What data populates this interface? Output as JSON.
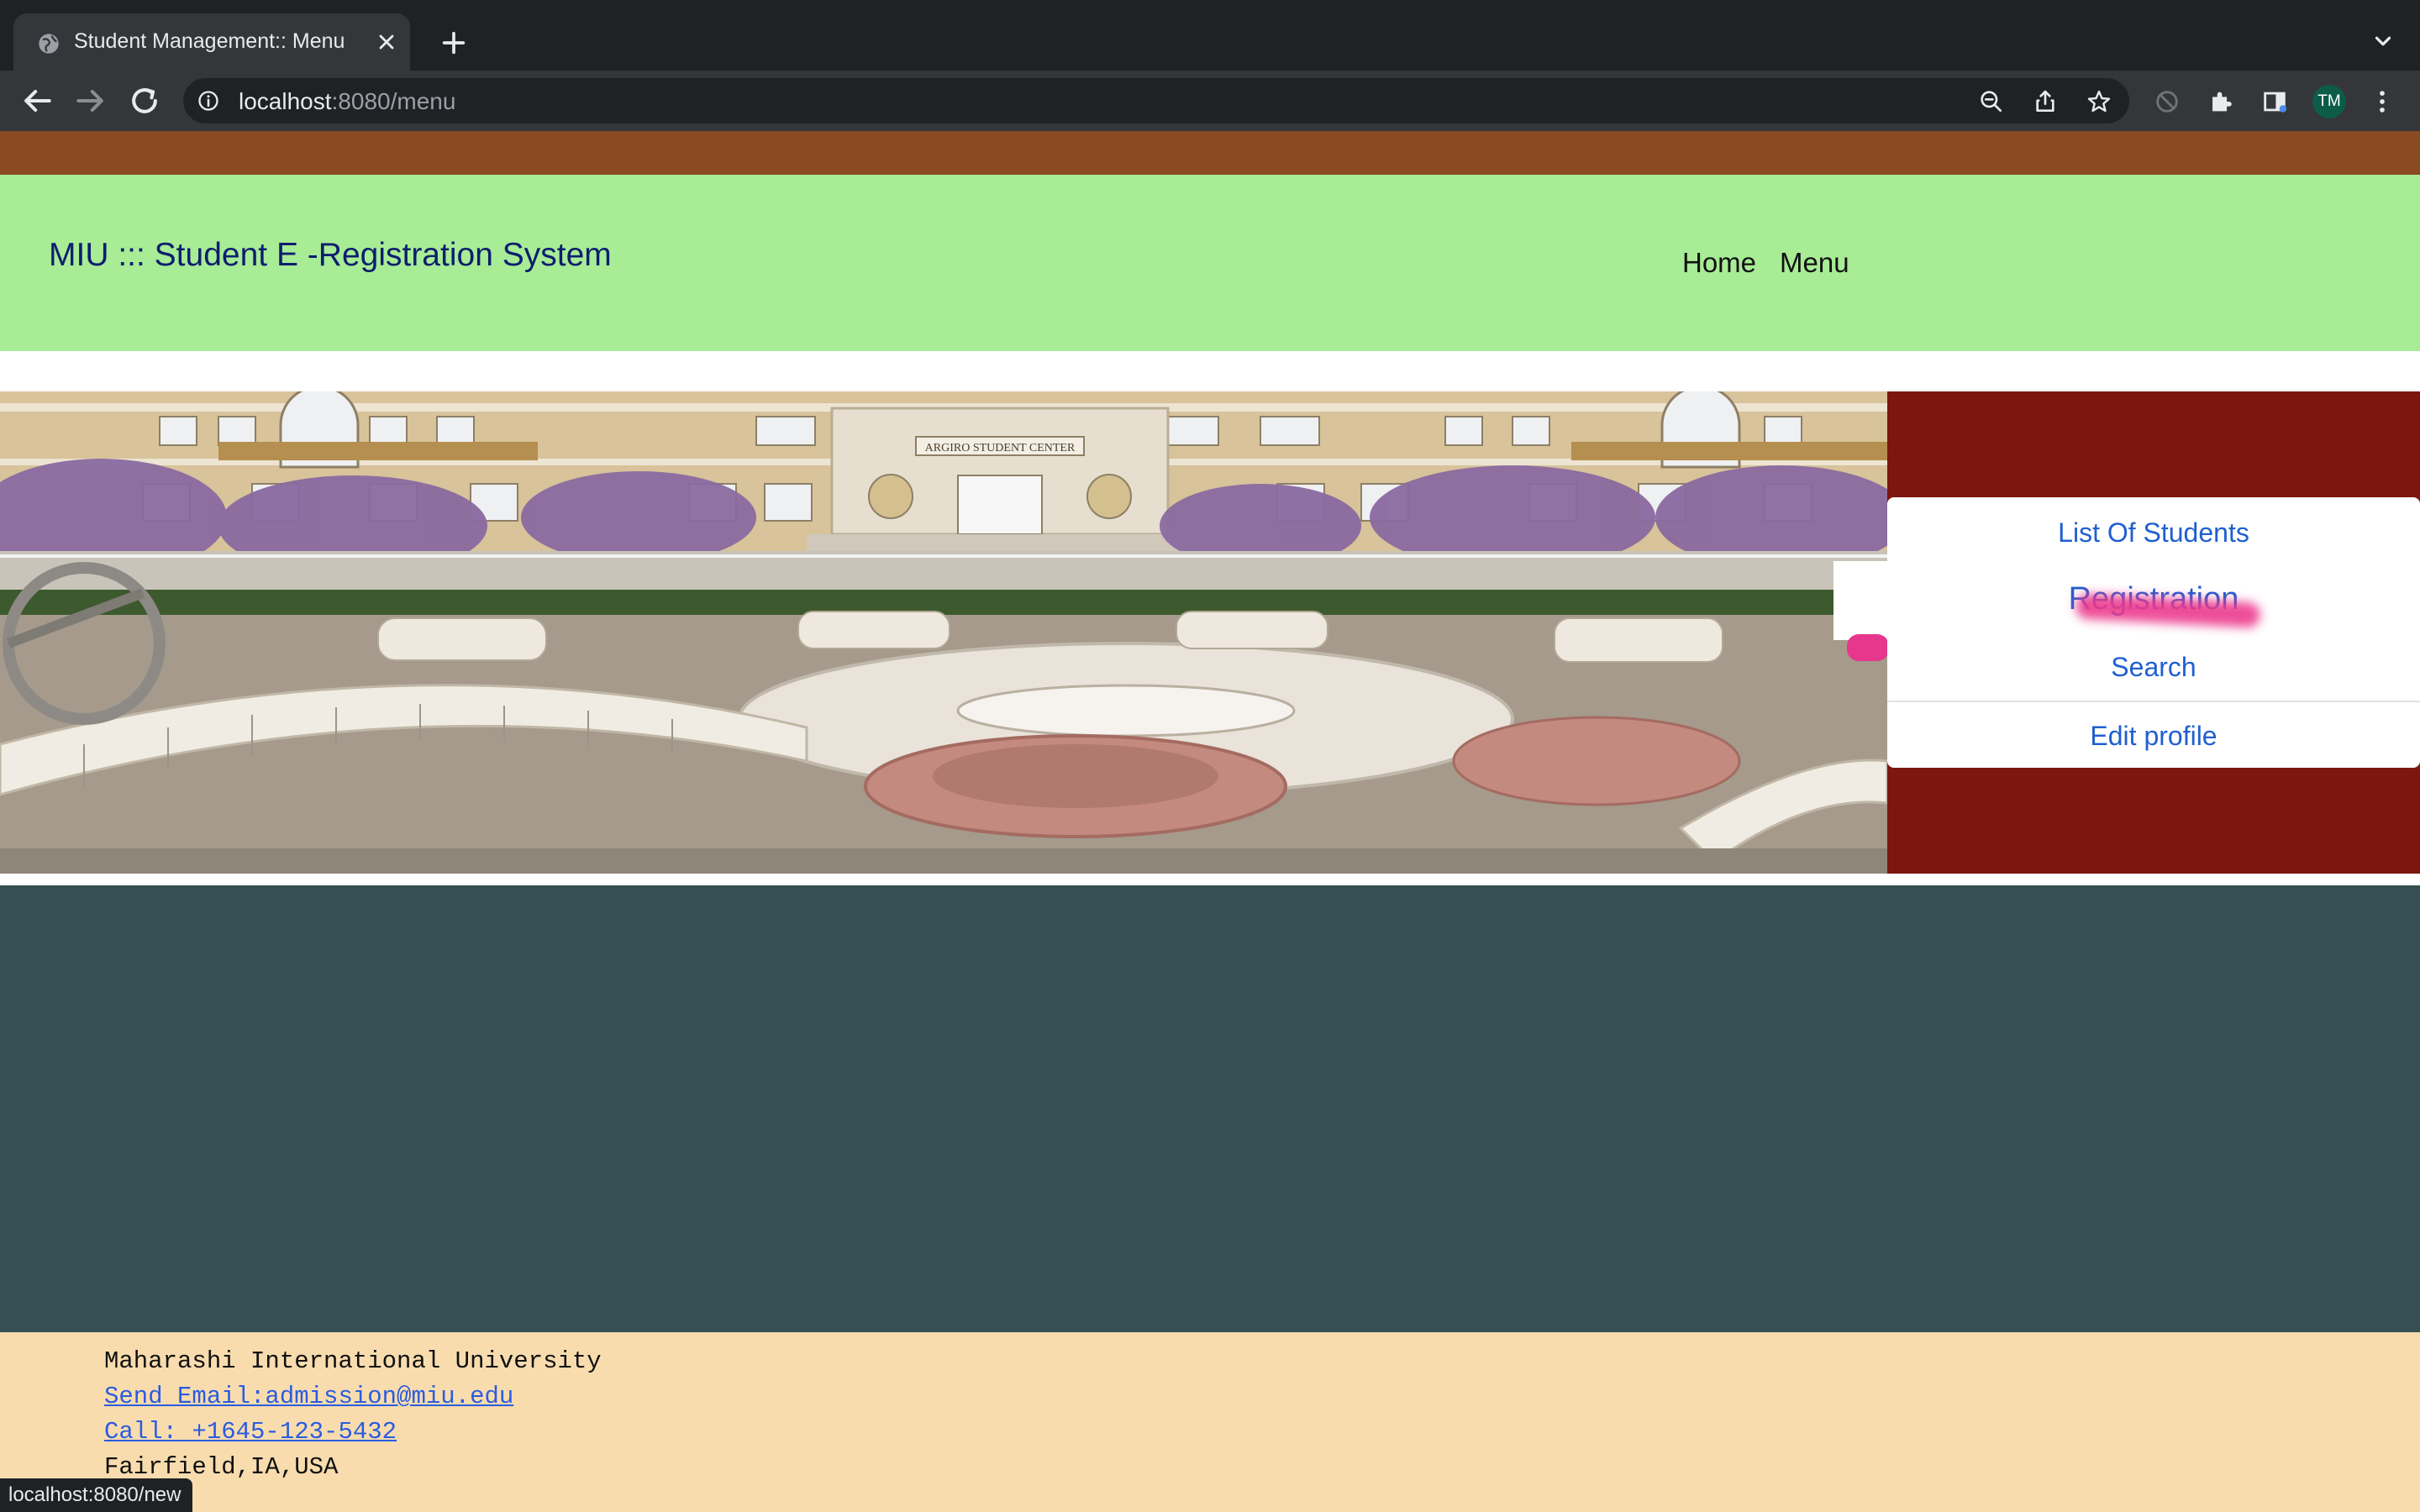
{
  "browser": {
    "tab_title": "Student Management:: Menu",
    "url_host": "localhost",
    "url_rest": ":8080/menu",
    "profile_initials": "TM",
    "status_url": "localhost:8080/new"
  },
  "header": {
    "brand": "MIU ::: Student E -Registration System",
    "nav": [
      "Home",
      "Menu"
    ]
  },
  "side_menu": {
    "items": [
      "List Of Students",
      "Registration",
      "Search",
      "Edit profile"
    ],
    "active_index": 1
  },
  "hero": {
    "building_sign": "ARGIRO STUDENT CENTER"
  },
  "footer": {
    "university": "Maharashi International University",
    "email": "Send Email:admission@miu.edu",
    "phone": "Call: +1645-123-5432",
    "location": "Fairfield,IA,USA"
  },
  "colors": {
    "brown_bar": "#8a4a22",
    "header_bg": "#a8ec96",
    "sidebar_bg": "#7c160f",
    "slate_bg": "#364f52",
    "footer_bg": "#f8dcae",
    "link": "#1f5fd0"
  }
}
